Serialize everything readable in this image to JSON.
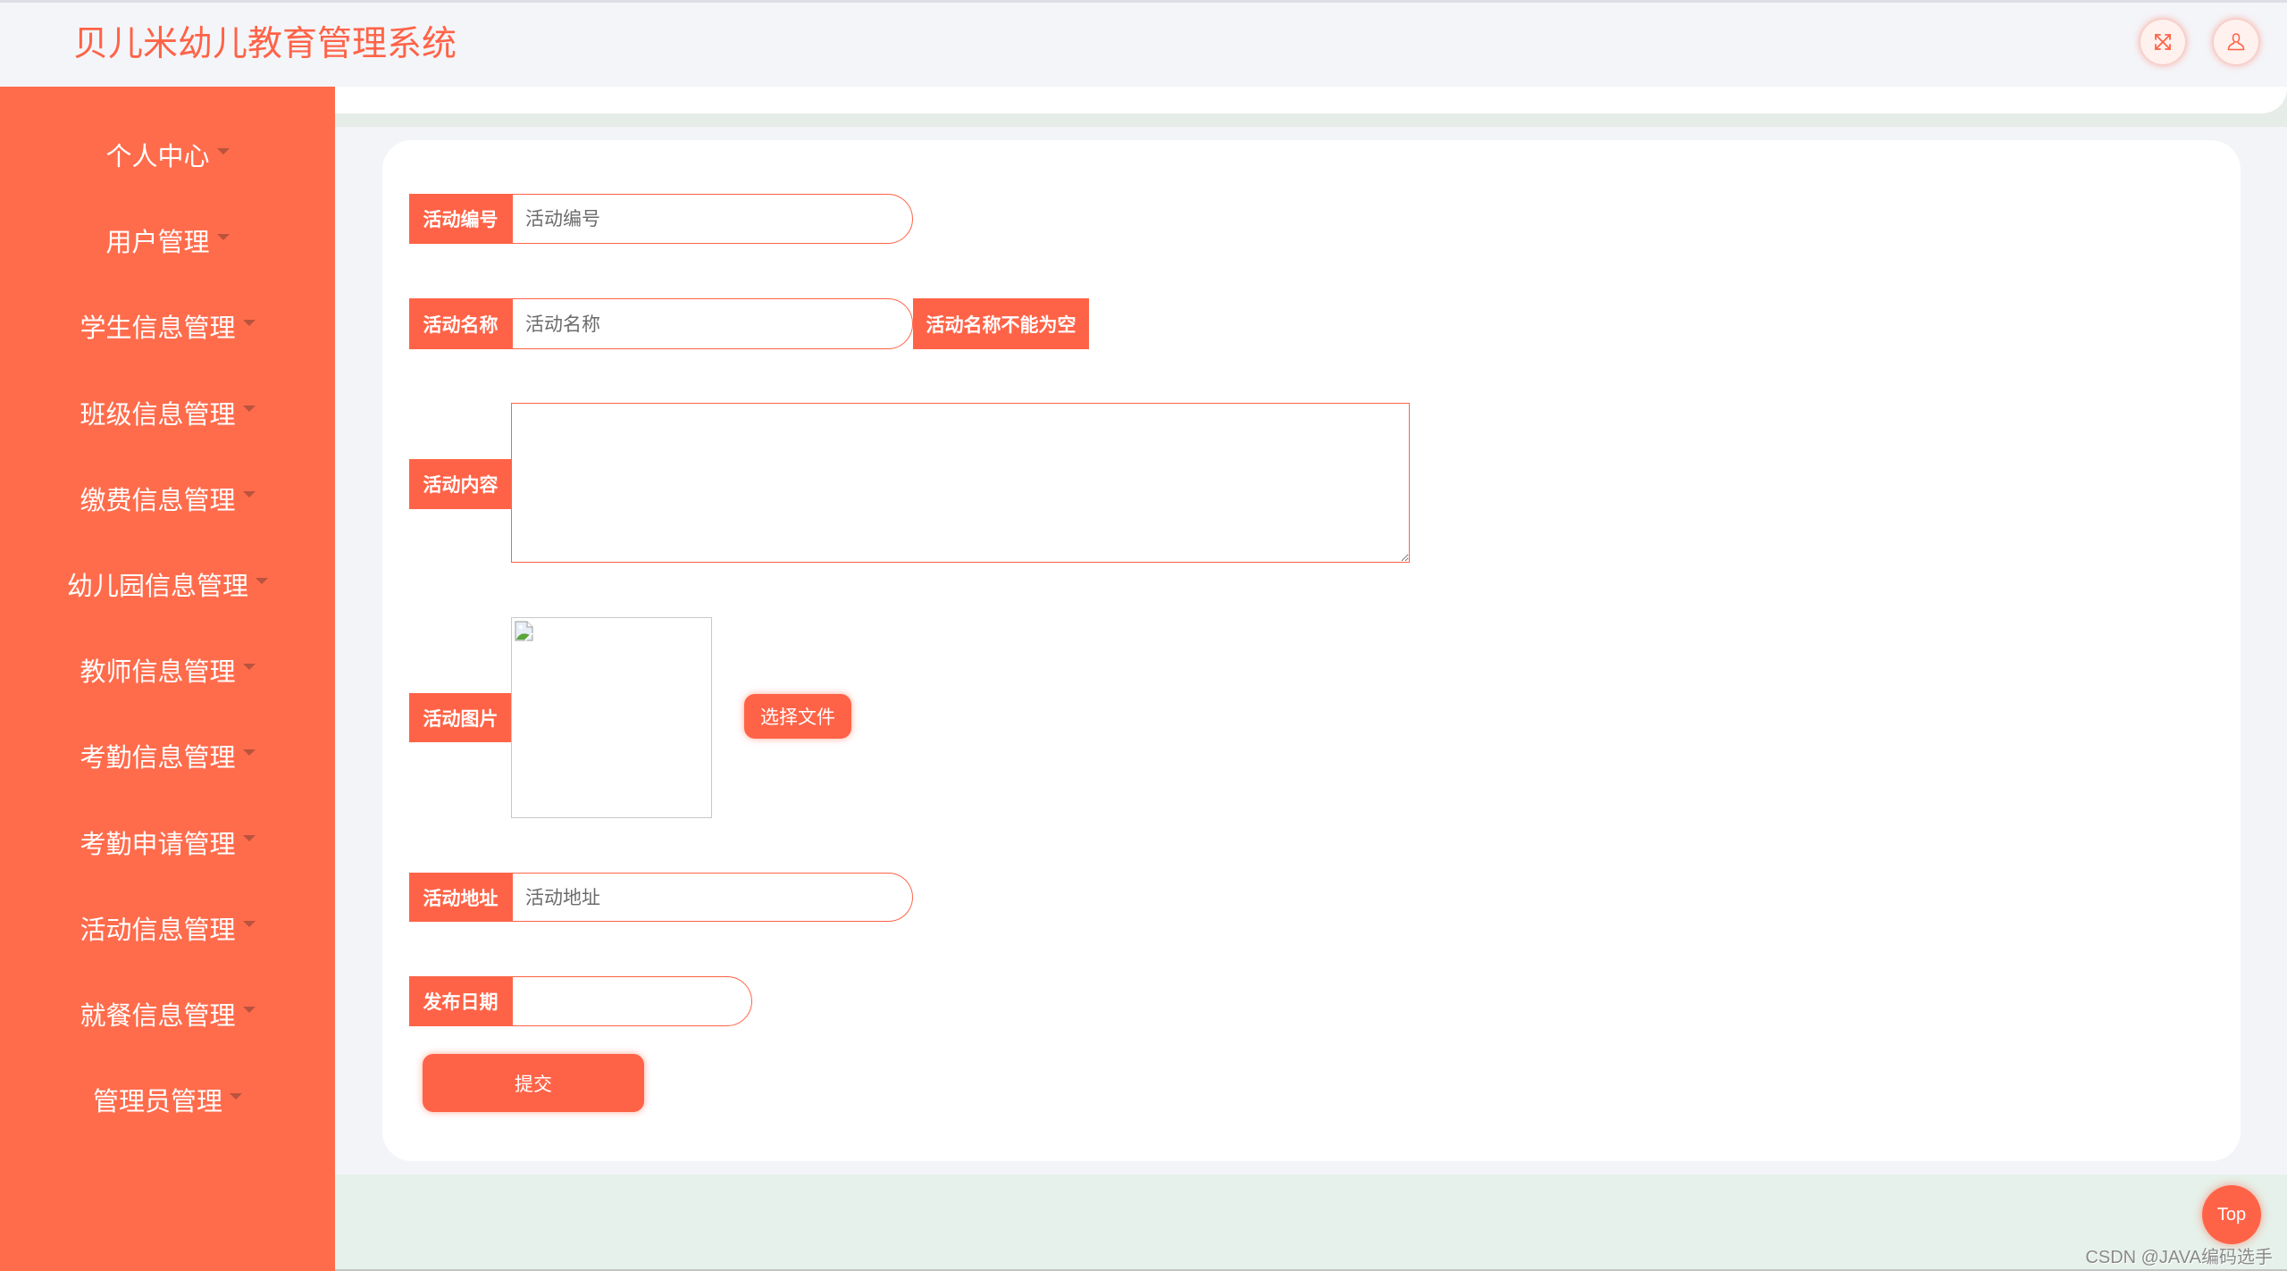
{
  "header": {
    "title": "贝儿米幼儿教育管理系统",
    "icons": {
      "fullscreen": "expand-arrows-icon",
      "user": "user-icon"
    }
  },
  "sidebar": {
    "items": [
      {
        "label": "个人中心"
      },
      {
        "label": "用户管理"
      },
      {
        "label": "学生信息管理"
      },
      {
        "label": "班级信息管理"
      },
      {
        "label": "缴费信息管理"
      },
      {
        "label": "幼儿园信息管理"
      },
      {
        "label": "教师信息管理"
      },
      {
        "label": "考勤信息管理"
      },
      {
        "label": "考勤申请管理"
      },
      {
        "label": "活动信息管理"
      },
      {
        "label": "就餐信息管理"
      },
      {
        "label": "管理员管理"
      }
    ]
  },
  "form": {
    "activity_no": {
      "label": "活动编号",
      "placeholder": "活动编号",
      "value": ""
    },
    "activity_name": {
      "label": "活动名称",
      "placeholder": "活动名称",
      "value": "",
      "error": "活动名称不能为空"
    },
    "activity_content": {
      "label": "活动内容",
      "value": ""
    },
    "activity_image": {
      "label": "活动图片",
      "choose_file_label": "选择文件"
    },
    "activity_address": {
      "label": "活动地址",
      "placeholder": "活动地址",
      "value": ""
    },
    "publish_date": {
      "label": "发布日期",
      "value": ""
    },
    "submit_label": "提交"
  },
  "back_to_top_label": "Top",
  "watermark": "CSDN @JAVA编码选手",
  "colors": {
    "accent": "#ff6347",
    "sidebar": "#ff6c4c",
    "bottom_band": "#e5f1ea"
  }
}
